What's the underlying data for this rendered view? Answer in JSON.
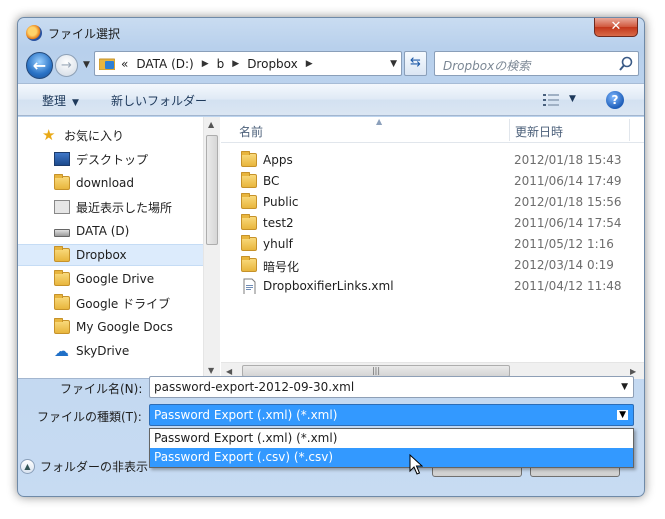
{
  "window": {
    "title": "ファイル選択",
    "close_label": "✕"
  },
  "address": {
    "overflow": "«",
    "crumbs": [
      "DATA (D:)",
      "b",
      "Dropbox"
    ],
    "search_placeholder": "Dropboxの検索"
  },
  "toolbar": {
    "organize": "整理",
    "new_folder": "新しいフォルダー",
    "help": "?"
  },
  "nav": {
    "items": [
      {
        "label": "お気に入り",
        "icon": "star-icon"
      },
      {
        "label": "デスクトップ",
        "icon": "desktop-icon"
      },
      {
        "label": "download",
        "icon": "folder-icon"
      },
      {
        "label": "最近表示した場所",
        "icon": "recent-places-icon"
      },
      {
        "label": "DATA (D)",
        "icon": "drive-icon"
      },
      {
        "label": "Dropbox",
        "icon": "dropbox-icon",
        "selected": true
      },
      {
        "label": "Google Drive",
        "icon": "google-drive-icon"
      },
      {
        "label": "Google ドライブ",
        "icon": "google-drive-icon"
      },
      {
        "label": "My Google Docs",
        "icon": "folder-icon"
      },
      {
        "label": "SkyDrive",
        "icon": "skydrive-icon"
      }
    ]
  },
  "files": {
    "columns": {
      "name": "名前",
      "date": "更新日時"
    },
    "rows": [
      {
        "name": "Apps",
        "date": "2012/01/18 15:43",
        "type": "folder"
      },
      {
        "name": "BC",
        "date": "2011/06/14 17:49",
        "type": "folder"
      },
      {
        "name": "Public",
        "date": "2012/01/18 15:56",
        "type": "folder"
      },
      {
        "name": "test2",
        "date": "2011/06/14 17:54",
        "type": "folder"
      },
      {
        "name": "yhulf",
        "date": "2011/05/12 1:16",
        "type": "folder"
      },
      {
        "name": "暗号化",
        "date": "2012/03/14 0:19",
        "type": "folder"
      },
      {
        "name": "DropboxifierLinks.xml",
        "date": "2011/04/12 11:48",
        "type": "xml"
      }
    ]
  },
  "form": {
    "filename_label": "ファイル名(N):",
    "filename_value": "password-export-2012-09-30.xml",
    "filetype_label": "ファイルの種類(T):",
    "filetype_value": "Password Export (.xml) (*.xml)",
    "filetype_options": [
      "Password Export (.xml) (*.xml)",
      "Password Export (.csv) (*.csv)"
    ],
    "hide_folders": "フォルダーの非表示"
  },
  "colors": {
    "accent": "#3399ff",
    "chrome": "#bcd3ee",
    "selection": "#dcebfc"
  }
}
